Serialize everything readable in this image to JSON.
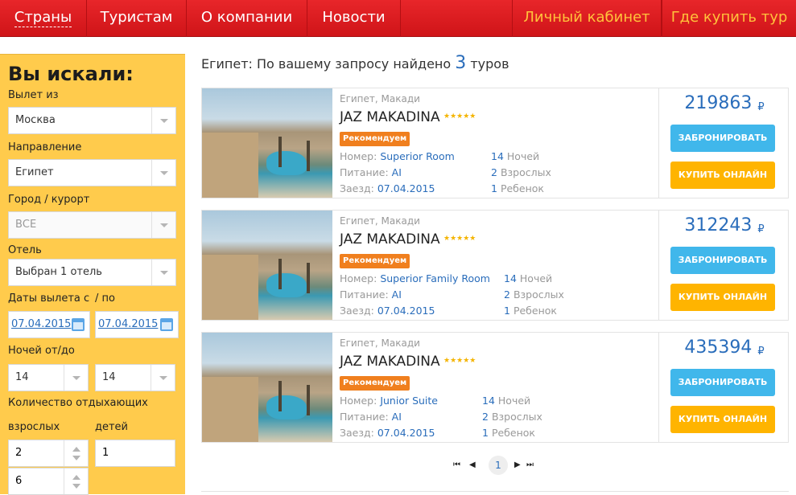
{
  "nav": {
    "items": [
      "Страны",
      "Туристам",
      "О компании",
      "Новости"
    ],
    "right": [
      "Личный кабинет",
      "Где купить тур"
    ]
  },
  "search": {
    "heading": "Вы искали:",
    "departure_label": "Вылет из",
    "departure_value": "Москва",
    "direction_label": "Направление",
    "direction_value": "Египет",
    "city_label": "Город / курорт",
    "city_value": "ВСЕ",
    "hotel_label": "Отель",
    "hotel_value": "Выбран 1 отель",
    "dates_from_label": "Даты вылета с",
    "dates_to_label": "/ по",
    "date_from": "07.04.2015",
    "date_to": "07.04.2015",
    "nights_label": "Ночей от/до",
    "nights_from": "14",
    "nights_to": "14",
    "people_label": "Количество отдыхающих",
    "adults_label": "взрослых",
    "children_label": "детей",
    "adults_value": "2",
    "children_value": "1",
    "extra_value": "6"
  },
  "results": {
    "title_prefix": "Египет: По вашему запросу найдено",
    "count": "3",
    "title_suffix": "туров",
    "tours": [
      {
        "location": "Египет, Макади",
        "hotel": "JAZ MAKADINA",
        "stars": "★★★★★",
        "badge": "Рекомендуем",
        "room_label": "Номер:",
        "room": "Superior Room",
        "meal_label": "Питание:",
        "meal": "AI",
        "checkin_label": "Заезд:",
        "checkin": "07.04.2015",
        "nights_num": "14",
        "nights_text": "Ночей",
        "adults_num": "2",
        "adults_text": "Взрослых",
        "children_num": "1",
        "children_text": "Ребенок",
        "price": "219863",
        "currency": "₽",
        "book_label": "ЗАБРОНИРОВАТЬ ТУР",
        "buy_label": "КУПИТЬ ОНЛАЙН"
      },
      {
        "location": "Египет, Макади",
        "hotel": "JAZ MAKADINA",
        "stars": "★★★★★",
        "badge": "Рекомендуем",
        "room_label": "Номер:",
        "room": "Superior Family Room",
        "meal_label": "Питание:",
        "meal": "AI",
        "checkin_label": "Заезд:",
        "checkin": "07.04.2015",
        "nights_num": "14",
        "nights_text": "Ночей",
        "adults_num": "2",
        "adults_text": "Взрослых",
        "children_num": "1",
        "children_text": "Ребенок",
        "price": "312243",
        "currency": "₽",
        "book_label": "ЗАБРОНИРОВАТЬ ТУР",
        "buy_label": "КУПИТЬ ОНЛАЙН"
      },
      {
        "location": "Египет, Макади",
        "hotel": "JAZ MAKADINA",
        "stars": "★★★★★",
        "badge": "Рекомендуем",
        "room_label": "Номер:",
        "room": "Junior Suite",
        "meal_label": "Питание:",
        "meal": "AI",
        "checkin_label": "Заезд:",
        "checkin": "07.04.2015",
        "nights_num": "14",
        "nights_text": "Ночей",
        "adults_num": "2",
        "adults_text": "Взрослых",
        "children_num": "1",
        "children_text": "Ребенок",
        "price": "435394",
        "currency": "₽",
        "book_label": "ЗАБРОНИРОВАТЬ ТУР",
        "buy_label": "КУПИТЬ ОНЛАЙН"
      }
    ]
  },
  "pager": {
    "first": "⏮",
    "prev": "◀",
    "current": "1",
    "next": "▶",
    "last": "⏭"
  },
  "colors": {
    "nav_red": "#e8262a",
    "sidebar_yellow": "#ffcb4c",
    "link_blue": "#2a6dbb",
    "book_blue": "#40b7eb",
    "buy_orange": "#ffb400",
    "badge_orange": "#f07f1e"
  }
}
